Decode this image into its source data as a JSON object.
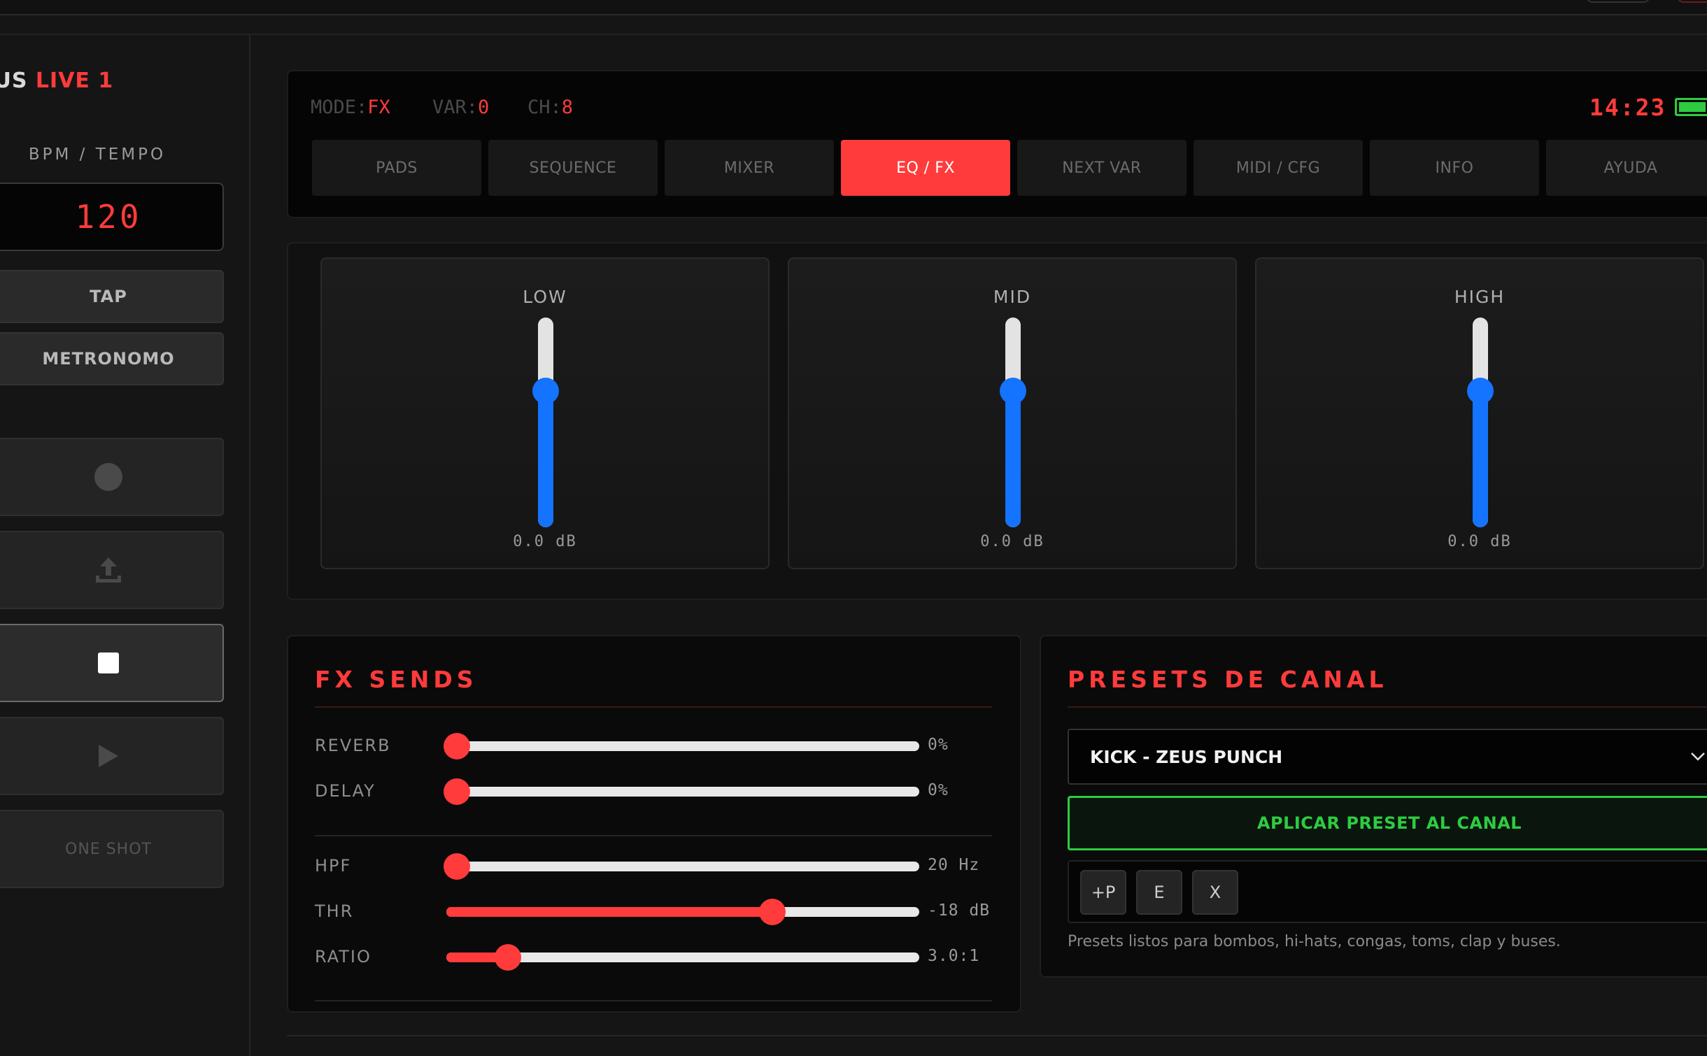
{
  "brand": {
    "prefix": "EUS",
    "accent": "LIVE 1"
  },
  "sidebar": {
    "bpm_label": "BPM / TEMPO",
    "bpm_value": "120",
    "tap_label": "TAP",
    "metronome_label": "METRONOMO",
    "transport": [
      {
        "name": "record",
        "icon": "record-icon"
      },
      {
        "name": "export",
        "icon": "upload-icon"
      },
      {
        "name": "stop",
        "icon": "stop-icon",
        "active": true
      },
      {
        "name": "play",
        "icon": "play-icon"
      }
    ],
    "oneshot_label": "ONE SHOT"
  },
  "display": {
    "mode_key": "MODE:",
    "mode_value": "FX",
    "var_key": "VAR:",
    "var_value": "0",
    "ch_key": "CH:",
    "ch_value": "8",
    "clock": "14:23",
    "tabs": [
      "PADS",
      "SEQUENCE",
      "MIXER",
      "EQ / FX",
      "NEXT VAR",
      "MIDI / CFG",
      "INFO",
      "AYUDA"
    ],
    "active_tab": "EQ / FX"
  },
  "eq": {
    "bands": [
      {
        "label": "LOW",
        "value": "0.0 dB",
        "level": 0.65
      },
      {
        "label": "MID",
        "value": "0.0 dB",
        "level": 0.65
      },
      {
        "label": "HIGH",
        "value": "0.0 dB",
        "level": 0.65
      }
    ]
  },
  "fx_sends": {
    "title": "FX SENDS",
    "sends": [
      {
        "label": "REVERB",
        "value": "0%",
        "level": 0.0
      },
      {
        "label": "DELAY",
        "value": "0%",
        "level": 0.0
      }
    ],
    "filters": [
      {
        "label": "HPF",
        "value": "20 Hz",
        "level": 0.0
      },
      {
        "label": "THR",
        "value": "-18 dB",
        "level": 0.69
      },
      {
        "label": "RATIO",
        "value": "3.0:1",
        "level": 0.13
      }
    ]
  },
  "presets": {
    "title": "PRESETS DE CANAL",
    "selected": "KICK - ZEUS PUNCH",
    "apply_label": "APLICAR PRESET AL CANAL",
    "actions": [
      "+P",
      "E",
      "X"
    ],
    "note": "Presets listos para bombos, hi-hats, congas, toms, clap y buses."
  },
  "colors": {
    "accent": "#ff3b3b",
    "eq_blue": "#1473ff",
    "ok_green": "#2ecc40"
  }
}
